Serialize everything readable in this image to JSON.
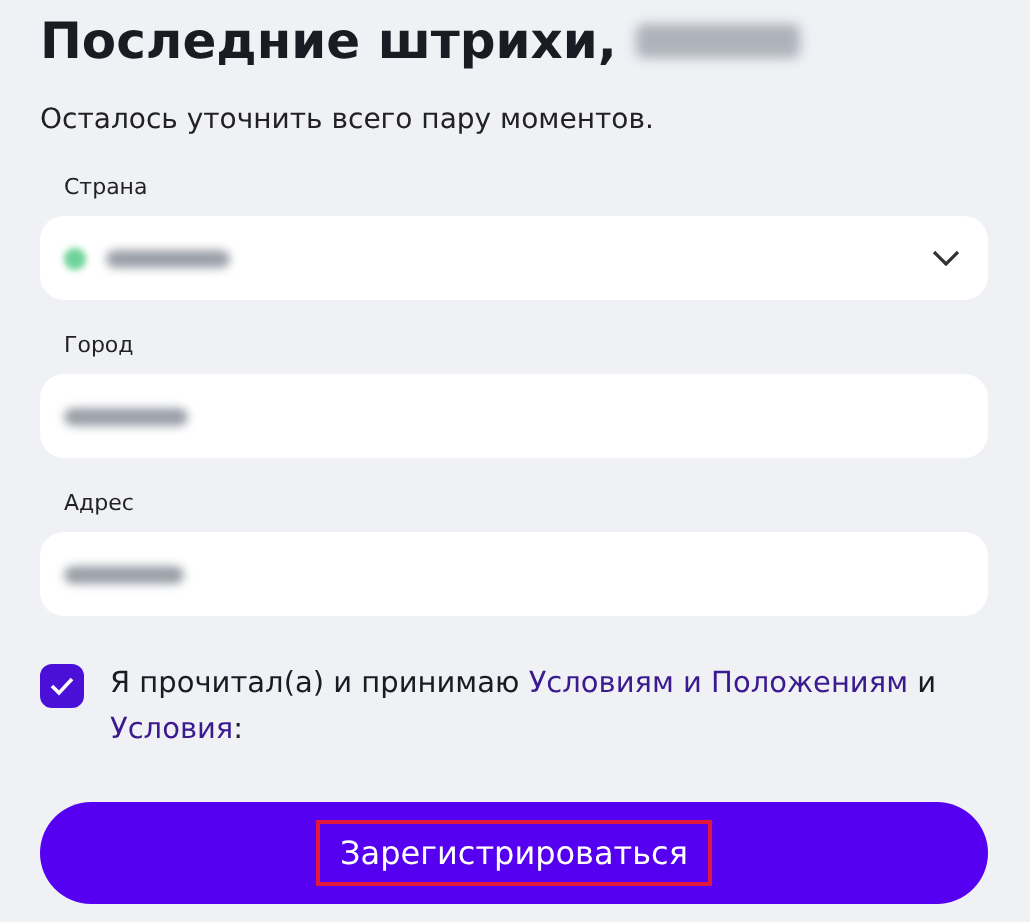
{
  "heading": {
    "title": "Последние штрихи,",
    "name_blurred": true
  },
  "subtitle": "Осталось уточнить всего пару моментов.",
  "fields": [
    {
      "kind": "select",
      "label": "Страна",
      "value_blurred": true
    },
    {
      "kind": "text",
      "label": "Город",
      "value_blurred": true
    },
    {
      "kind": "text",
      "label": "Адрес",
      "value_blurred": true
    }
  ],
  "agreement": {
    "checked": true,
    "parts": [
      {
        "kind": "text",
        "text": "Я прочитал(а) и принимаю "
      },
      {
        "kind": "link",
        "text": "Условиям и Положениям"
      },
      {
        "kind": "text",
        "text": " и "
      },
      {
        "kind": "link",
        "text": "Условия"
      },
      {
        "kind": "text",
        "text": ":"
      }
    ]
  },
  "submit": {
    "label": "Зарегистрироваться",
    "highlighted": true
  }
}
